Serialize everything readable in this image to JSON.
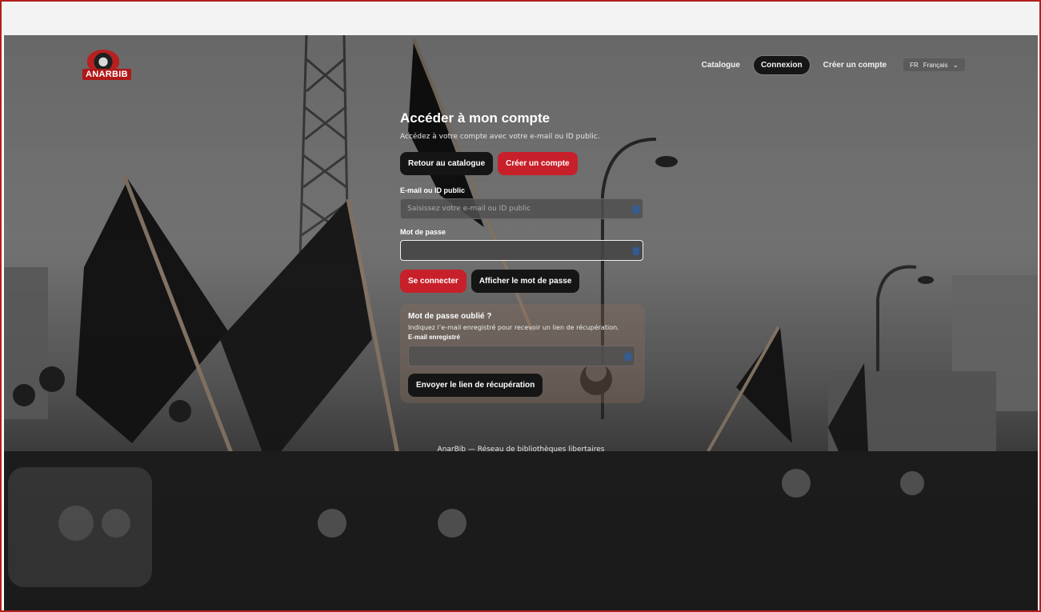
{
  "brand": {
    "logo_text": "ANARBIB"
  },
  "nav": {
    "items": [
      {
        "label": "Catalogue",
        "active": false
      },
      {
        "label": "Connexion",
        "active": true
      },
      {
        "label": "Créer un compte",
        "active": false
      }
    ],
    "language": {
      "flag": "FR",
      "label": "Français"
    }
  },
  "login": {
    "title": "Accéder à mon compte",
    "subtitle": "Accédez à votre compte avec votre e-mail ou ID public.",
    "back_button": "Retour au catalogue",
    "create_button": "Créer un compte",
    "email_label": "E-mail ou ID public",
    "email_placeholder": "Saisissez votre e-mail ou ID public",
    "email_value": "",
    "password_label": "Mot de passe",
    "password_value": "",
    "submit_button": "Se connecter",
    "show_password_button": "Afficher le mot de passe"
  },
  "forgot": {
    "title": "Mot de passe oublié ?",
    "description": "Indiquez l’e-mail enregistré pour recevoir un lien de récupération.",
    "email_label": "E-mail enregistré",
    "email_value": "",
    "send_button": "Envoyer le lien de récupération"
  },
  "footer": {
    "text": "AnarBib — Réseau de bibliothèques libertaires"
  },
  "colors": {
    "accent_red": "#c8202a",
    "dark_button": "#151515",
    "frame_border": "#b02020"
  }
}
